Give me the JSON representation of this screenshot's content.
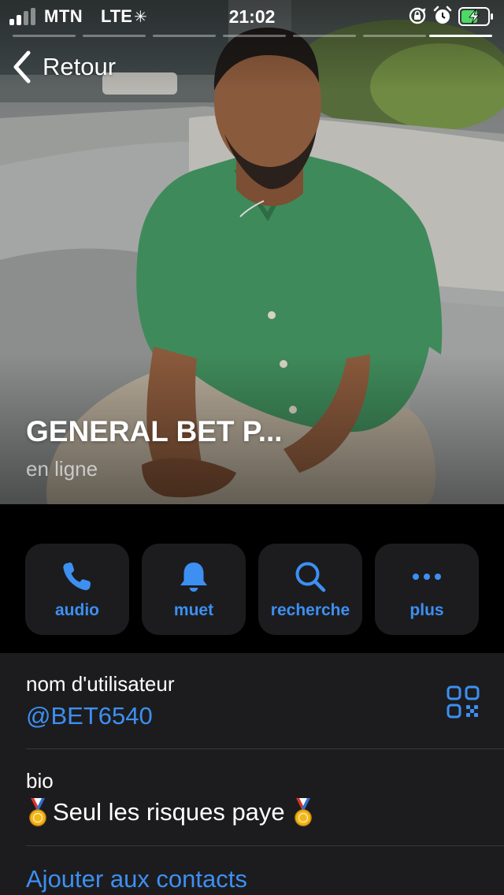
{
  "status_bar": {
    "carrier": "MTN",
    "network": "LTE",
    "time": "21:02"
  },
  "nav": {
    "back_label": "Retour"
  },
  "profile": {
    "name": "GENERAL BET P...",
    "status": "en ligne"
  },
  "actions": [
    {
      "label": "audio",
      "icon": "phone-icon"
    },
    {
      "label": "muet",
      "icon": "bell-icon"
    },
    {
      "label": "recherche",
      "icon": "search-icon"
    },
    {
      "label": "plus",
      "icon": "more-icon"
    }
  ],
  "info": {
    "username_label": "nom d'utilisateur",
    "username_value": "@BET6540",
    "bio_label": "bio",
    "bio_text": "Seul les risques paye",
    "add_contact_label": "Ajouter aux contacts"
  },
  "colors": {
    "accent": "#3d8ff2",
    "card_background": "#1c1c1e",
    "page_background": "#000000",
    "battery_fill": "#4cd964"
  }
}
